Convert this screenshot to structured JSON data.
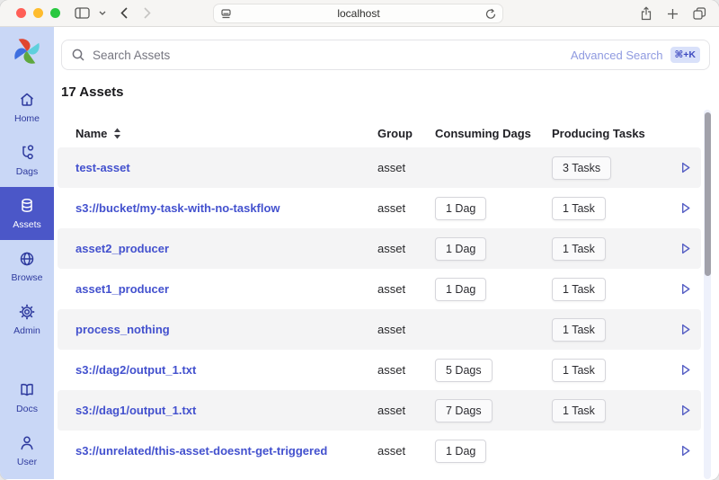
{
  "browser": {
    "url": "localhost"
  },
  "sidebar": {
    "items": [
      {
        "label": "Home",
        "icon": "home-icon",
        "active": false
      },
      {
        "label": "Dags",
        "icon": "dags-icon",
        "active": false
      },
      {
        "label": "Assets",
        "icon": "assets-icon",
        "active": true
      },
      {
        "label": "Browse",
        "icon": "browse-icon",
        "active": false
      },
      {
        "label": "Admin",
        "icon": "admin-icon",
        "active": false
      }
    ],
    "bottom_items": [
      {
        "label": "Docs",
        "icon": "docs-icon"
      },
      {
        "label": "User",
        "icon": "user-icon"
      }
    ]
  },
  "search": {
    "placeholder": "Search Assets",
    "advanced_label": "Advanced Search",
    "shortcut": "⌘+K"
  },
  "main": {
    "heading": "17 Assets",
    "table": {
      "columns": [
        "Name",
        "Group",
        "Consuming Dags",
        "Producing Tasks"
      ],
      "rows": [
        {
          "name": "test-asset",
          "group": "asset",
          "consuming": "",
          "producing": "3 Tasks"
        },
        {
          "name": "s3://bucket/my-task-with-no-taskflow",
          "group": "asset",
          "consuming": "1 Dag",
          "producing": "1 Task"
        },
        {
          "name": "asset2_producer",
          "group": "asset",
          "consuming": "1 Dag",
          "producing": "1 Task"
        },
        {
          "name": "asset1_producer",
          "group": "asset",
          "consuming": "1 Dag",
          "producing": "1 Task"
        },
        {
          "name": "process_nothing",
          "group": "asset",
          "consuming": "",
          "producing": "1 Task"
        },
        {
          "name": "s3://dag2/output_1.txt",
          "group": "asset",
          "consuming": "5 Dags",
          "producing": "1 Task"
        },
        {
          "name": "s3://dag1/output_1.txt",
          "group": "asset",
          "consuming": "7 Dags",
          "producing": "1 Task"
        },
        {
          "name": "s3://unrelated/this-asset-doesnt-get-triggered",
          "group": "asset",
          "consuming": "1 Dag",
          "producing": ""
        }
      ]
    }
  },
  "colors": {
    "sidebar_bg": "#c9d7f6",
    "sidebar_active_bg": "#4b57c8",
    "sidebar_text": "#2e3a9e",
    "link_blue": "#4351ce",
    "row_alt_bg": "#f4f4f5",
    "badge_bg": "#d9e1fa",
    "traffic_red": "#ff5f57",
    "traffic_yellow": "#febc2e",
    "traffic_green": "#28c840"
  }
}
